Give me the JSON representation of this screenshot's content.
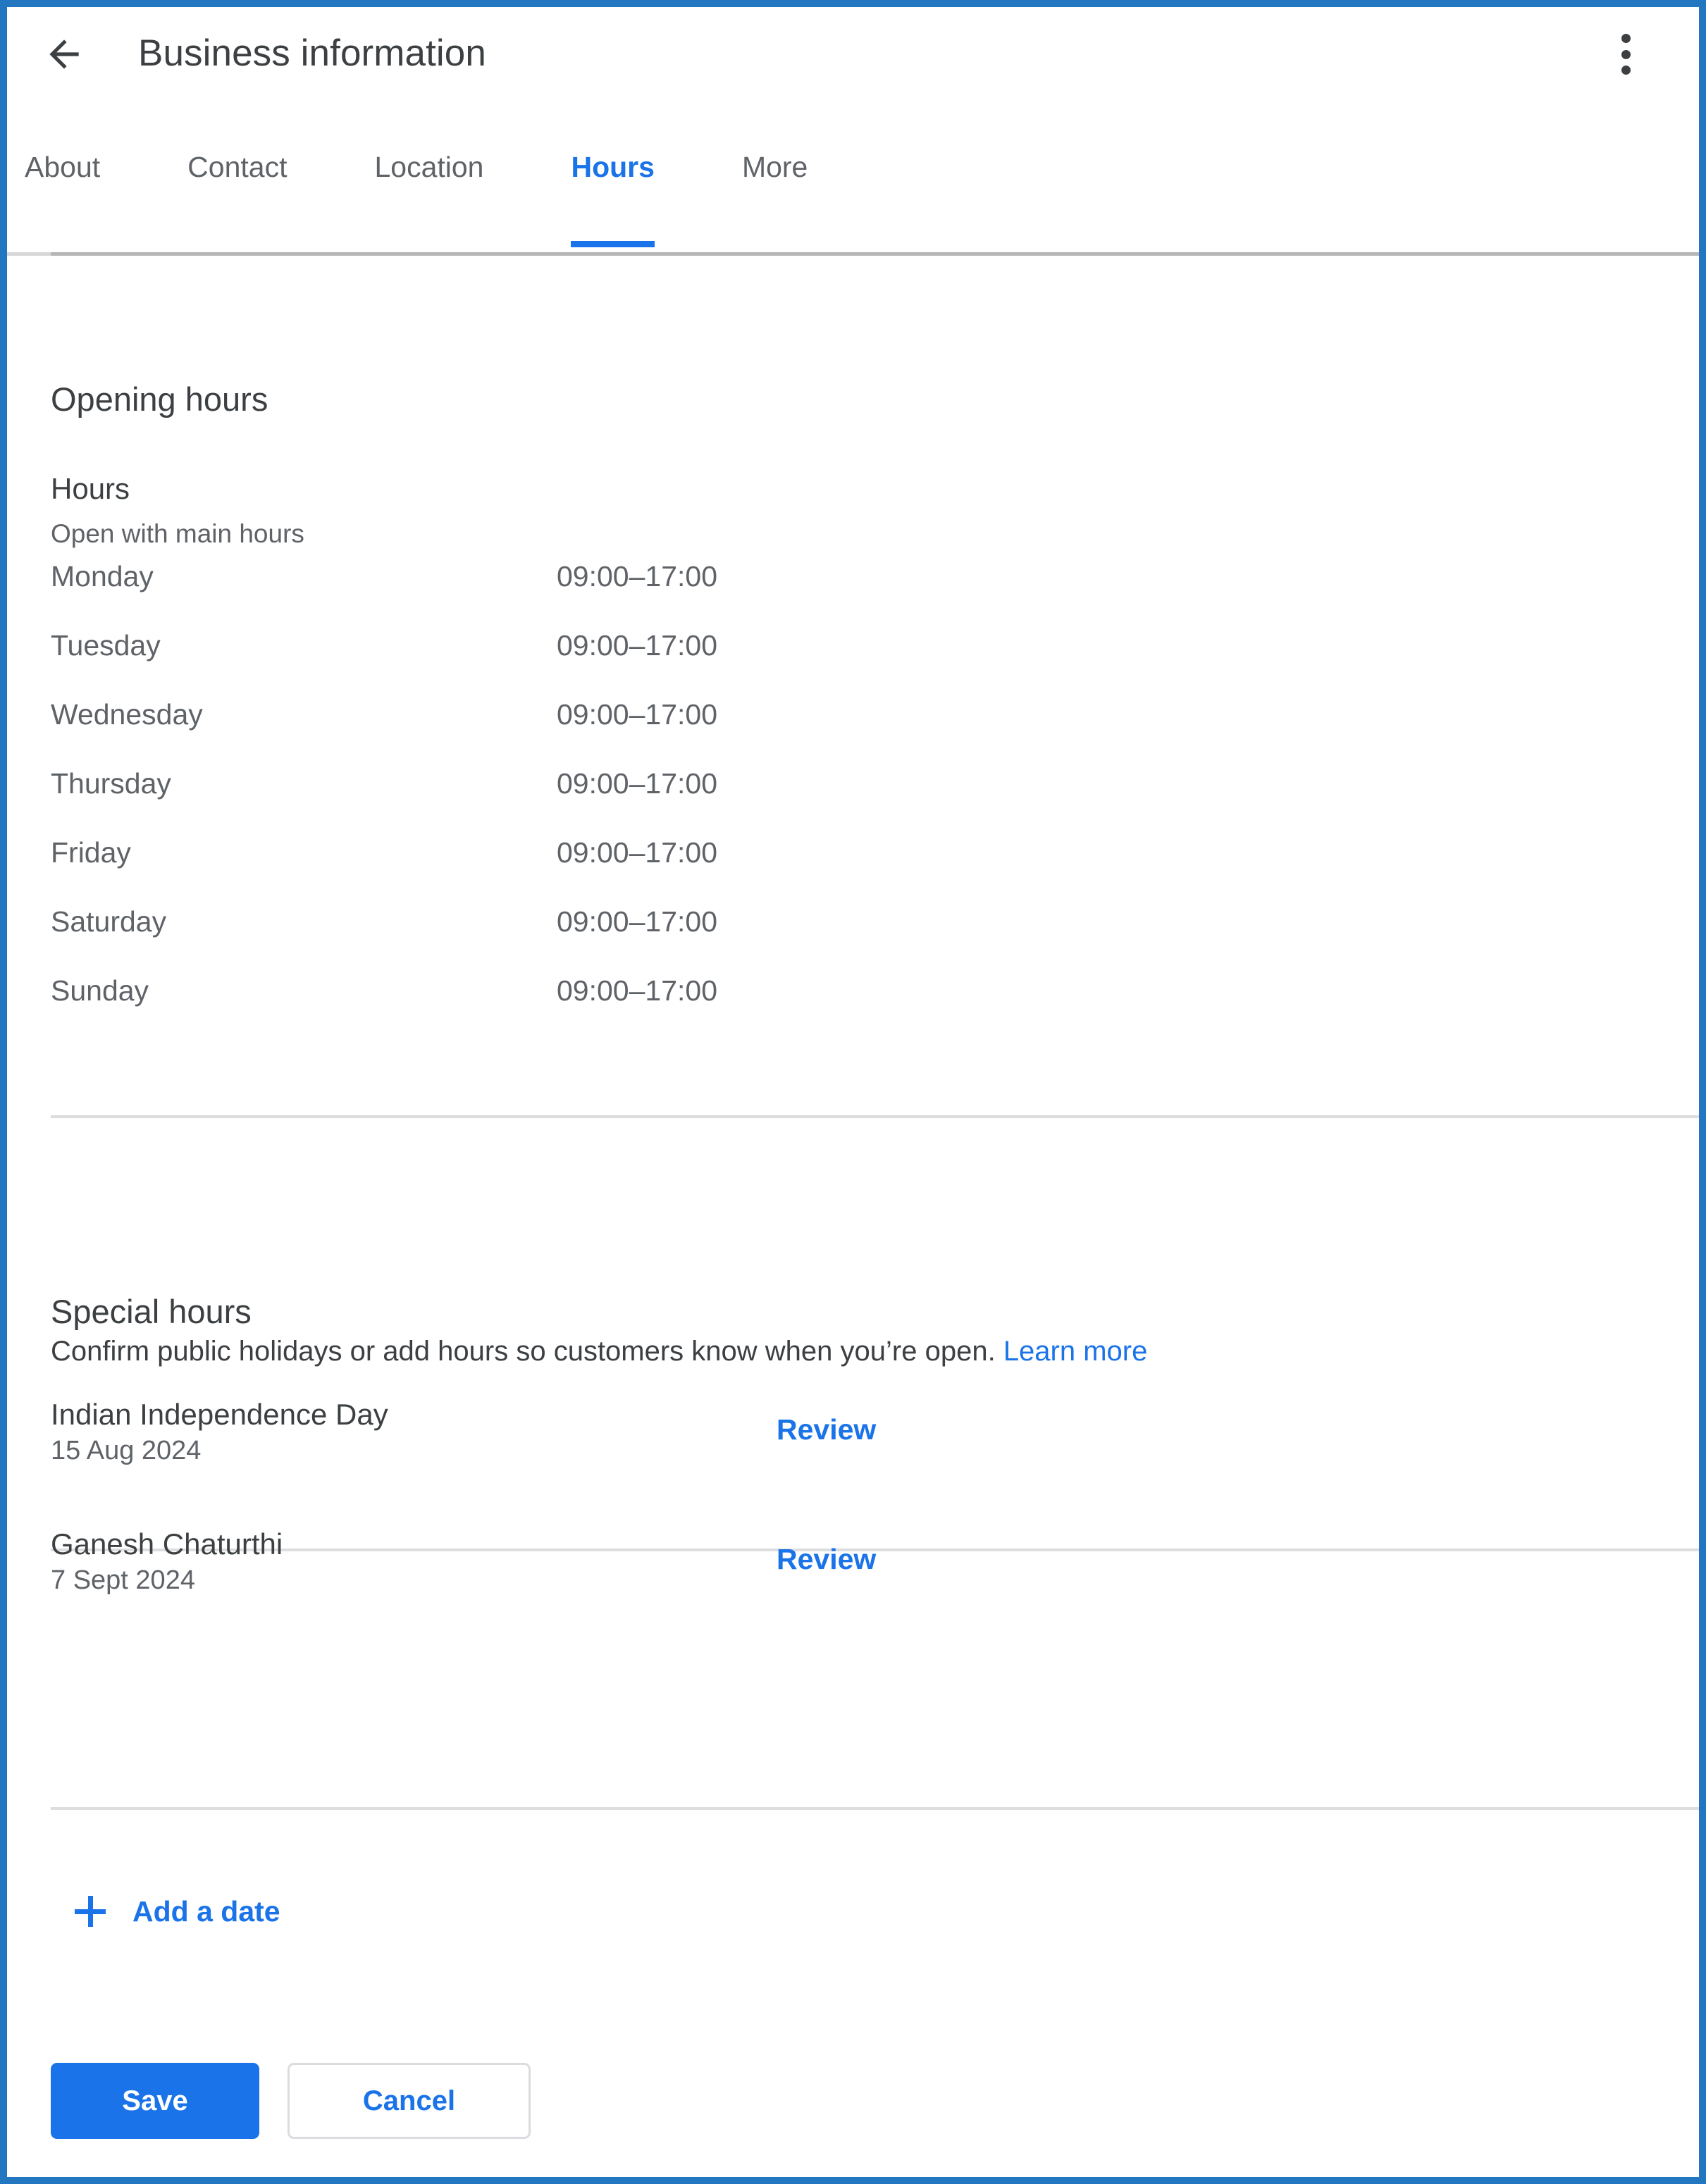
{
  "header": {
    "title": "Business information",
    "back_icon": "back-arrow-icon",
    "overflow_icon": "more-vert-icon"
  },
  "tabs": [
    {
      "label": "About",
      "active": false
    },
    {
      "label": "Contact",
      "active": false
    },
    {
      "label": "Location",
      "active": false
    },
    {
      "label": "Hours",
      "active": true
    },
    {
      "label": "More",
      "active": false
    }
  ],
  "opening_hours": {
    "section_title": "Opening hours",
    "sub_title": "Hours",
    "status": "Open with main hours",
    "rows": [
      {
        "day": "Monday",
        "time": "09:00–17:00"
      },
      {
        "day": "Tuesday",
        "time": "09:00–17:00"
      },
      {
        "day": "Wednesday",
        "time": "09:00–17:00"
      },
      {
        "day": "Thursday",
        "time": "09:00–17:00"
      },
      {
        "day": "Friday",
        "time": "09:00–17:00"
      },
      {
        "day": "Saturday",
        "time": "09:00–17:00"
      },
      {
        "day": "Sunday",
        "time": "09:00–17:00"
      }
    ]
  },
  "special_hours": {
    "section_title": "Special hours",
    "description": "Confirm public holidays or add hours so customers know when you’re open.",
    "learn_more": "Learn more",
    "entries": [
      {
        "name": "Indian Independence Day",
        "date": "15 Aug 2024",
        "action": "Review"
      },
      {
        "name": "Ganesh Chaturthi",
        "date": "7 Sept 2024",
        "action": "Review"
      }
    ],
    "add_date_label": "Add a date",
    "add_icon": "plus-icon"
  },
  "footer": {
    "save_label": "Save",
    "cancel_label": "Cancel"
  },
  "colors": {
    "accent": "#1a73e8",
    "frame": "#2277c0",
    "text_primary": "#3c4043",
    "text_secondary": "#5f6368",
    "divider": "#dcdddf"
  }
}
